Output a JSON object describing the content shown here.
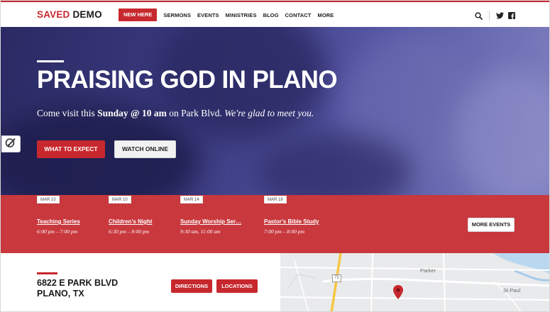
{
  "header": {
    "logo_red": "SAVED",
    "logo_dark": "DEMO",
    "new_here": "NEW HERE",
    "nav": [
      "SERMONS",
      "EVENTS",
      "MINISTRIES",
      "BLOG",
      "CONTACT",
      "MORE"
    ]
  },
  "hero": {
    "title": "PRAISING GOD IN PLANO",
    "sub_pre": "Come visit this ",
    "sub_bold": "Sunday @ 10 am",
    "sub_mid": " on Park Blvd. ",
    "sub_ital": "We're glad to meet you.",
    "btn_expect": "WHAT TO EXPECT",
    "btn_watch": "WATCH ONLINE"
  },
  "events": {
    "items": [
      {
        "date": "MAR 10",
        "title": "Teaching Series",
        "time": "6:00 pm – 7:00 pm"
      },
      {
        "date": "MAR 10",
        "title": "Children's Night",
        "time": "6:30 pm – 8:00 pm"
      },
      {
        "date": "MAR 14",
        "title": "Sunday Worship Ser…",
        "time": "9:30 am, 11:00 am"
      },
      {
        "date": "MAR 18",
        "title": "Pastor's Bible Study",
        "time": "7:00 pm – 8:00 pm"
      }
    ],
    "more": "MORE EVENTS"
  },
  "location": {
    "line1": "6822 E PARK BLVD",
    "line2": "PLANO, TX",
    "directions": "DIRECTIONS",
    "locations": "LOCATIONS"
  },
  "map": {
    "labels": [
      "Parker",
      "St Paul",
      "75"
    ]
  },
  "colors": {
    "accent": "#c7282e",
    "band": "#c8383d",
    "hero": "#3a3a7f"
  },
  "icons": [
    "search-icon",
    "twitter-icon",
    "facebook-icon",
    "paint-brush-icon",
    "map-pin-icon"
  ]
}
